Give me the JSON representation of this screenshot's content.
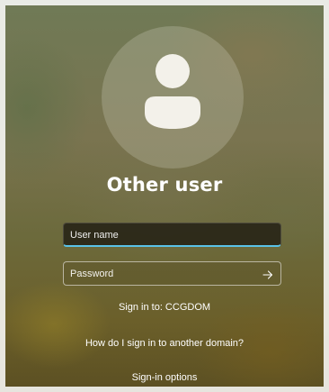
{
  "login": {
    "title": "Other user",
    "username_placeholder": "User name",
    "password_placeholder": "Password",
    "sign_in_to": "Sign in to: CCGDOM",
    "other_domain_link": "How do I sign in to another domain?",
    "sign_in_options": "Sign-in options"
  },
  "icons": {
    "avatar": "user-silhouette-icon",
    "submit": "arrow-right-icon"
  },
  "colors": {
    "focus_accent": "#59c2e8"
  }
}
